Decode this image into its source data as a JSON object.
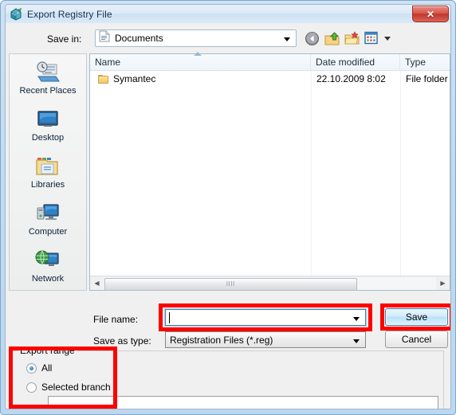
{
  "window": {
    "title": "Export Registry File",
    "title_icon": "registry-editor-icon",
    "close_label": "✕"
  },
  "savein": {
    "label": "Save in:",
    "value": "Documents",
    "icon": "document-icon",
    "dropdown_icon": "chevron-down-icon"
  },
  "toolbar": {
    "back_icon": "back-arrow-icon",
    "up_icon": "up-one-level-icon",
    "newfolder_icon": "new-folder-icon",
    "views_icon": "views-icon",
    "views_dropdown_icon": "chevron-down-icon"
  },
  "places": {
    "items": [
      {
        "label": "Recent Places",
        "icon": "recent-places-icon"
      },
      {
        "label": "Desktop",
        "icon": "desktop-icon"
      },
      {
        "label": "Libraries",
        "icon": "libraries-icon"
      },
      {
        "label": "Computer",
        "icon": "computer-icon"
      },
      {
        "label": "Network",
        "icon": "network-icon"
      }
    ]
  },
  "filelist": {
    "columns": [
      "Name",
      "Date modified",
      "Type"
    ],
    "sort_indicator": "sort-ascending-icon",
    "rows": [
      {
        "name": "Symantec",
        "date_modified": "22.10.2009 8:02",
        "type": "File folder",
        "icon": "folder-icon"
      }
    ],
    "scrollbar": {
      "left_arrow": "◀",
      "right_arrow": "▶",
      "grip": "llll"
    }
  },
  "filename": {
    "label": "File name:",
    "value": "",
    "placeholder": "",
    "dropdown_icon": "chevron-down-icon"
  },
  "savetype": {
    "label": "Save as type:",
    "value": "Registration Files (*.reg)",
    "dropdown_icon": "chevron-down-icon"
  },
  "buttons": {
    "save": "Save",
    "cancel": "Cancel"
  },
  "export_range": {
    "title": "Export range",
    "options": [
      {
        "label": "All",
        "selected": true
      },
      {
        "label": "Selected branch",
        "selected": false
      }
    ],
    "branch_value": ""
  },
  "colors": {
    "highlight": "#ff0000",
    "accent": "#3c7fb1",
    "title_text": "#17334d",
    "close_button": "#c1362c"
  }
}
